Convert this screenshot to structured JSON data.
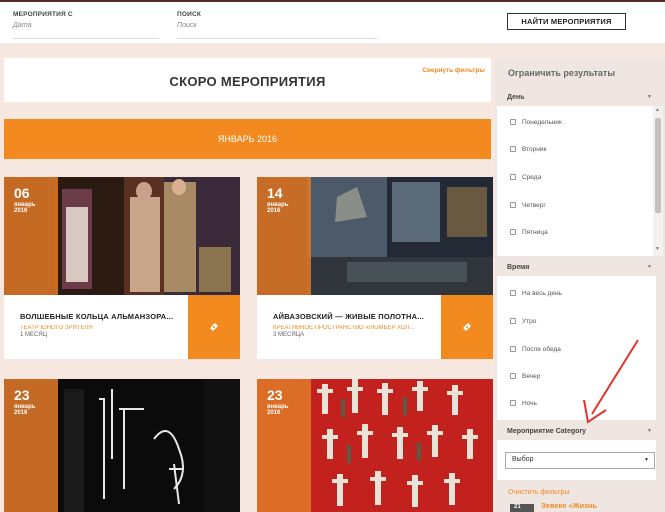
{
  "topbar": {
    "events_from_label": "МЕРОПРИЯТИЯ С",
    "events_from_placeholder": "Дата",
    "search_label": "ПОИСК",
    "search_placeholder": "Поиск",
    "find_button": "НАЙТИ МЕРОПРИЯТИЯ"
  },
  "main": {
    "heading": "СКОРО МЕРОПРИЯТИЯ",
    "collapse_filters": "Свернуть фильтры",
    "month": "ЯНВАРЬ 2016",
    "events": [
      {
        "day": "06",
        "month": "январь",
        "year": "2016",
        "title": "ВОЛШЕБНЫЕ КОЛЬЦА АЛЬМАНЗОРА...",
        "venue": "ТЕАТР ЮНОГО ЗРИТЕЛЯ",
        "duration": "1 МЕСЯЦ"
      },
      {
        "day": "14",
        "month": "январь",
        "year": "2016",
        "title": "АЙВАЗОВСКИЙ — ЖИВЫЕ ПОЛОТНА...",
        "venue": "КРЕАТИВНОЕ ПРОСТРАНСТВО «ЛЮМЬЕР ХОЛ...",
        "duration": "3 МЕСЯЦА"
      },
      {
        "day": "23",
        "month": "январь",
        "year": "2016"
      },
      {
        "day": "23",
        "month": "январь",
        "year": "2016"
      }
    ]
  },
  "sidebar": {
    "heading": "Ограничить результаты",
    "day_section": "День",
    "days": [
      "Понедельник",
      "Вторник",
      "Среда",
      "Четверг",
      "Пятница"
    ],
    "time_section": "Время",
    "times": [
      "На весь день",
      "Утро",
      "После обеда",
      "Вечер",
      "Ночь"
    ],
    "category_section": "Мероприятие Category",
    "category_select": "Выбор",
    "clear_filters": "Очистить фильтры",
    "mini_event_badge": "21",
    "mini_event_title": "Зевеке «Жизнь"
  }
}
